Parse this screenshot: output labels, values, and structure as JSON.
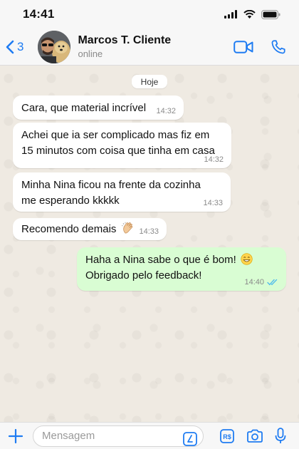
{
  "status_bar": {
    "time": "14:41"
  },
  "header": {
    "back_count": "3",
    "contact_name": "Marcos T. Cliente",
    "contact_status": "online"
  },
  "chat": {
    "date_label": "Hoje",
    "messages": [
      {
        "direction": "in",
        "text": "Cara, que material incrível",
        "time": "14:32"
      },
      {
        "direction": "in",
        "text": "Achei que ia ser complicado mas fiz em 15 minutos com coisa que tinha em casa",
        "line1": "Achei que ia ser complicado mas fiz em",
        "line2": "15 minutos com coisa que tinha em casa",
        "time": "14:32"
      },
      {
        "direction": "in",
        "text": "Minha Nina ficou na frente da cozinha me esperando kkkkk",
        "line1": "Minha Nina ficou na frente da cozinha",
        "line2": "me esperando kkkkk",
        "time": "14:33"
      },
      {
        "direction": "in",
        "text": "Recomendo demais 👏",
        "line1": "Recomendo demais",
        "time": "14:33"
      },
      {
        "direction": "out",
        "text": "Haha a Nina sabe o que é bom! 😄 Obrigado pelo feedback!",
        "line1": "Haha a Nina sabe o que é bom!",
        "line2": "Obrigado pelo feedback!",
        "time": "14:40",
        "status": "read"
      }
    ]
  },
  "composer": {
    "placeholder": "Mensagem"
  },
  "colors": {
    "accent": "#1f7cf2",
    "incoming_bubble": "#ffffff",
    "outgoing_bubble": "#d9fdd3",
    "chat_background": "#efeae2",
    "read_ticks": "#53bdeb"
  },
  "icons": [
    "signal-icon",
    "wifi-icon",
    "battery-icon",
    "back-chevron-icon",
    "video-call-icon",
    "phone-icon",
    "plus-icon",
    "sticker-icon",
    "payment-icon",
    "camera-icon",
    "microphone-icon",
    "clapping-hands-emoji",
    "grinning-emoji",
    "read-ticks-icon"
  ]
}
